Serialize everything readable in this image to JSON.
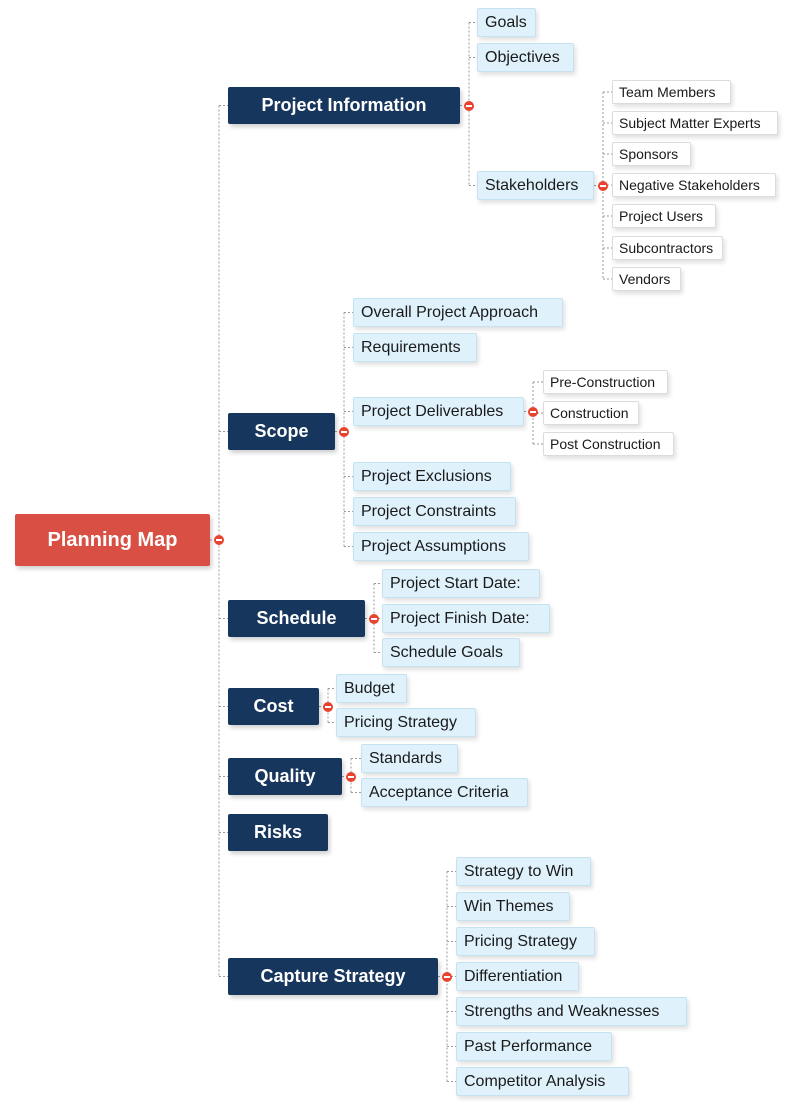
{
  "diagram": {
    "type": "mind-map",
    "colors": {
      "root": "#d94f43",
      "main": "#17365d",
      "sub": "#dff1fb",
      "leaf": "#ffffff",
      "collapse": "#e8432f",
      "connector": "#9a9a9a"
    },
    "root": {
      "label": "Planning Map",
      "children": [
        {
          "label": "Project Information",
          "children": [
            {
              "label": "Goals"
            },
            {
              "label": "Objectives"
            },
            {
              "label": "Stakeholders",
              "children": [
                {
                  "label": "Team Members"
                },
                {
                  "label": "Subject Matter Experts"
                },
                {
                  "label": "Sponsors"
                },
                {
                  "label": "Negative Stakeholders"
                },
                {
                  "label": "Project Users"
                },
                {
                  "label": "Subcontractors"
                },
                {
                  "label": "Vendors"
                }
              ]
            }
          ]
        },
        {
          "label": "Scope",
          "children": [
            {
              "label": "Overall Project Approach"
            },
            {
              "label": "Requirements"
            },
            {
              "label": "Project Deliverables",
              "children": [
                {
                  "label": "Pre-Construction"
                },
                {
                  "label": "Construction"
                },
                {
                  "label": "Post Construction"
                }
              ]
            },
            {
              "label": "Project Exclusions"
            },
            {
              "label": "Project Constraints"
            },
            {
              "label": "Project Assumptions"
            }
          ]
        },
        {
          "label": "Schedule",
          "children": [
            {
              "label": "Project Start Date:"
            },
            {
              "label": "Project Finish Date:"
            },
            {
              "label": "Schedule Goals"
            }
          ]
        },
        {
          "label": "Cost",
          "children": [
            {
              "label": "Budget"
            },
            {
              "label": "Pricing Strategy"
            }
          ]
        },
        {
          "label": "Quality",
          "children": [
            {
              "label": "Standards"
            },
            {
              "label": "Acceptance Criteria"
            }
          ]
        },
        {
          "label": "Risks",
          "children": []
        },
        {
          "label": "Capture Strategy",
          "children": [
            {
              "label": "Strategy to Win"
            },
            {
              "label": "Win Themes"
            },
            {
              "label": "Pricing Strategy"
            },
            {
              "label": "Differentiation"
            },
            {
              "label": "Strengths and Weaknesses"
            },
            {
              "label": "Past Performance"
            },
            {
              "label": "Competitor Analysis"
            }
          ]
        }
      ]
    }
  }
}
